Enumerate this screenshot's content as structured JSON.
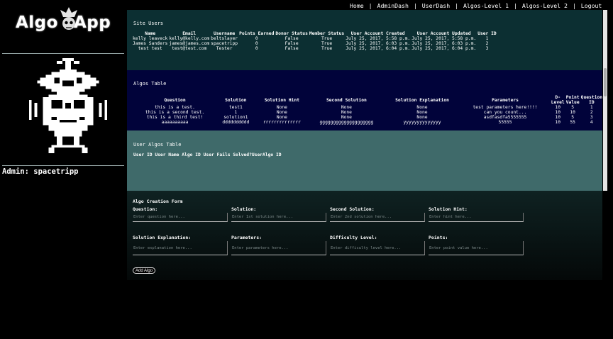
{
  "nav": {
    "items": [
      "Home",
      "AdminDash",
      "UserDash",
      "Algos-Level 1",
      "Algos-Level 2",
      "Logout"
    ],
    "separator": "|"
  },
  "brand": {
    "word1": "Algo",
    "word2": "App"
  },
  "sidebar": {
    "admin_label": "Admin: spacetripp"
  },
  "site_users": {
    "title": "Site Users",
    "columns": [
      "Name",
      "Email",
      "Username",
      "Points Earned",
      "Donor Status",
      "Member Status",
      "User Account Created",
      "User Account Updated",
      "User ID"
    ],
    "rows": [
      [
        "kelly leaveck",
        "kelly@kelly.com",
        "beltslayer",
        "0",
        "False",
        "True",
        "July 25, 2017, 5:58 p.m.",
        "July 25, 2017, 5:58 p.m.",
        "1"
      ],
      [
        "James Sanders",
        "james@james.com",
        "spacetripp",
        "0",
        "False",
        "True",
        "July 25, 2017, 6:03 p.m.",
        "July 25, 2017, 6:03 p.m.",
        "2"
      ],
      [
        "test test",
        "test@test.com",
        "Tester",
        "0",
        "False",
        "True",
        "July 25, 2017, 6:04 p.m.",
        "July 25, 2017, 6:04 p.m.",
        "3"
      ]
    ]
  },
  "algos_table": {
    "title": "Algos Table",
    "columns": [
      "Question",
      "Solution",
      "Solution Hint",
      "Second Solution",
      "Solution Explanation",
      "Parameters",
      "D-Level",
      "Point Value",
      "Question ID"
    ],
    "rows": [
      [
        "this is a test.",
        "test1",
        "None",
        "None",
        "None",
        "test parameters here!!!!",
        "10",
        "5",
        "1"
      ],
      [
        "this is a second test.",
        "1",
        "None",
        "None",
        "None",
        "can you count...",
        "10",
        "10",
        "2"
      ],
      [
        "this is a third test!",
        "solution1",
        "None",
        "None",
        "None",
        "asdfasdfa5555555",
        "10",
        "5",
        "3"
      ],
      [
        "aaaaaaaaaa",
        "dddddddddd",
        "rrrrrrrrrrrrrr",
        "gggggggggggggggggggg",
        "yyyyyyyyyyyyyy",
        "55555",
        "10",
        "55",
        "4"
      ]
    ]
  },
  "user_algos": {
    "title": "User Algos Table",
    "columns": [
      "User ID",
      "User Name",
      "Algo ID",
      "User Fails",
      "Solved?",
      "UserAlgo ID"
    ]
  },
  "form": {
    "title": "Algo Creation Form",
    "fields": [
      {
        "label": "Question:",
        "placeholder": "Enter question here..."
      },
      {
        "label": "Solution:",
        "placeholder": "Enter 1st solution here..."
      },
      {
        "label": "Second Solution:",
        "placeholder": "Enter 2nd solution here..."
      },
      {
        "label": "Solution Hint:",
        "placeholder": "Enter hint here..."
      },
      {
        "label": "Solution Explanation:",
        "placeholder": "Enter explanation here..."
      },
      {
        "label": "Parameters:",
        "placeholder": "Enter parameters here..."
      },
      {
        "label": "Difficulty Level:",
        "placeholder": "Enter difficulty level here..."
      },
      {
        "label": "Points:",
        "placeholder": "Enter point value here..."
      }
    ],
    "submit_label": "Add Algo"
  }
}
